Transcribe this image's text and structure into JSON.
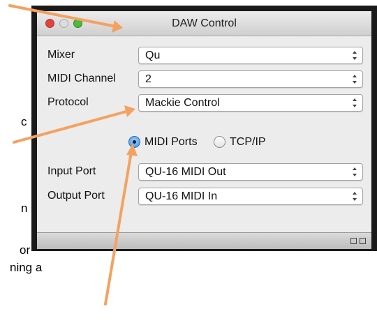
{
  "window": {
    "title": "DAW Control"
  },
  "form": {
    "mixer_label": "Mixer",
    "mixer_value": "Qu",
    "channel_label": "MIDI Channel",
    "channel_value": "2",
    "protocol_label": "Protocol",
    "protocol_value": "Mackie Control",
    "radio_midi_label": "MIDI Ports",
    "radio_tcp_label": "TCP/IP",
    "input_label": "Input Port",
    "input_value": "QU-16 MIDI Out",
    "output_label": "Output Port",
    "output_value": "QU-16 MIDI In"
  },
  "background_fragments": [
    "c",
    "n",
    "or",
    "ning a"
  ],
  "colors": {
    "arrow": "#F4A261",
    "close": "#e0443e",
    "minimize": "#d9d9d9",
    "zoom": "#4cbb3c"
  }
}
